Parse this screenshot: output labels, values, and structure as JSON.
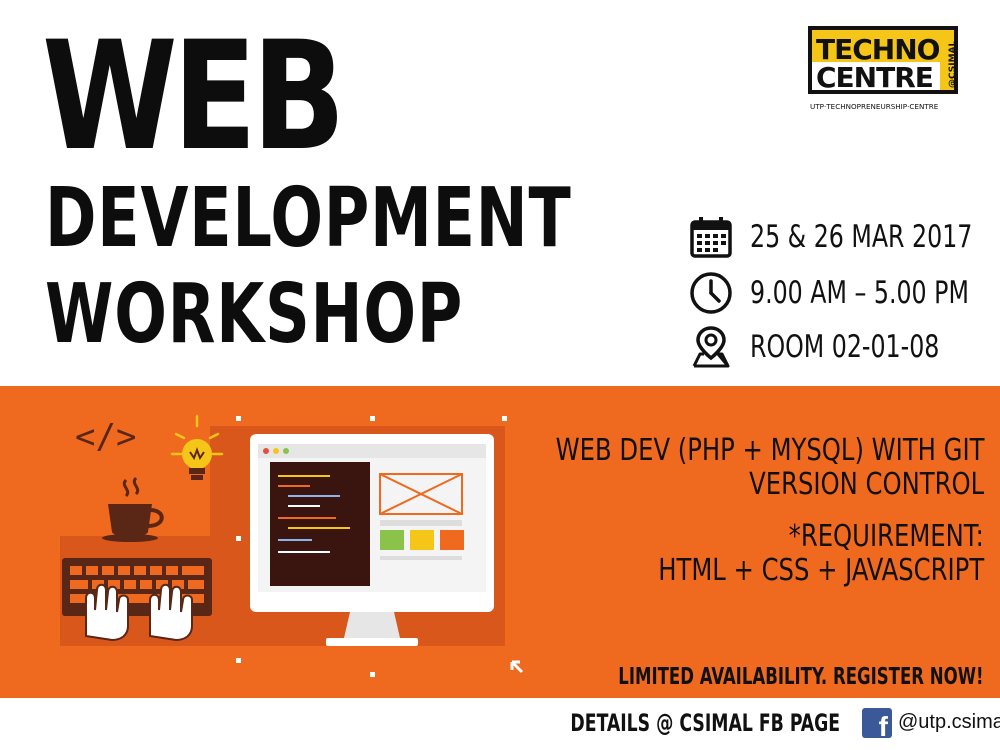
{
  "title": {
    "line1": "WEB",
    "line2": "DEVELOPMENT",
    "line3": "WORKSHOP"
  },
  "logo": {
    "line1": "TECHNO",
    "line2": "CENTRE",
    "side": "@CSIMAL",
    "tagline": "UTP·TECHNOPRENEURSHIP·CENTRE"
  },
  "info": {
    "date": "25 & 26 MAR  2017",
    "time": "9.00 AM – 5.00 PM",
    "venue": "ROOM 02-01-08"
  },
  "band": {
    "topic_line1": "WEB DEV (PHP + MYSQL) WITH GIT",
    "topic_line2": "VERSION CONTROL",
    "req_line1": "*REQUIREMENT:",
    "req_line2": "HTML + CSS + JAVASCRIPT",
    "cta": "LIMITED AVAILABILITY. REGISTER NOW!"
  },
  "illustration": {
    "code_tag": "</>"
  },
  "footer": {
    "details": "DETAILS @ CSIMAL FB PAGE",
    "fb_letter": "f",
    "fb_handle": "@utp.csimal"
  },
  "colors": {
    "orange": "#ef6a1f",
    "dark_orange": "#c9531a",
    "yellow": "#f5c518",
    "facebook": "#3b5998"
  },
  "icons": [
    "calendar-icon",
    "clock-icon",
    "location-pin-icon",
    "facebook-icon",
    "coffee-cup-icon",
    "lightbulb-icon",
    "keyboard-icon",
    "monitor-icon",
    "cursor-arrow-icon"
  ]
}
